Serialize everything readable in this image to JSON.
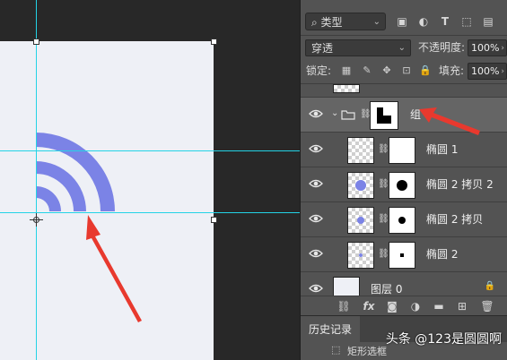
{
  "filter": {
    "label": "类型",
    "icons": [
      "image-filter-icon",
      "adjustment-filter-icon",
      "type-filter-icon",
      "shape-filter-icon",
      "smart-object-filter-icon"
    ],
    "type_glyph": "T"
  },
  "blend": {
    "mode": "穿透",
    "opacity_label": "不透明度:",
    "opacity_value": "100%"
  },
  "lock": {
    "label": "锁定:",
    "fill_label": "填充:",
    "fill_value": "100%"
  },
  "layers": [
    {
      "name": "组",
      "kind": "group",
      "selected": true
    },
    {
      "name": "椭圆 1",
      "kind": "shape"
    },
    {
      "name": "椭圆 2 拷贝 2",
      "kind": "shape"
    },
    {
      "name": "椭圆 2 拷贝",
      "kind": "shape"
    },
    {
      "name": "椭圆 2",
      "kind": "shape"
    },
    {
      "name": "图层 0",
      "kind": "pixel"
    }
  ],
  "bottom_tools": {
    "fx": "fx"
  },
  "history": {
    "tab_label": "历史记录",
    "row_label": "矩形选框"
  },
  "watermark": "头条 @123是圆圆啊",
  "colors": {
    "arc": "#7b83e6",
    "guide": "#23d3e6",
    "arrow": "#e8392e",
    "canvas": "#eef0f6",
    "panel": "#535353"
  }
}
